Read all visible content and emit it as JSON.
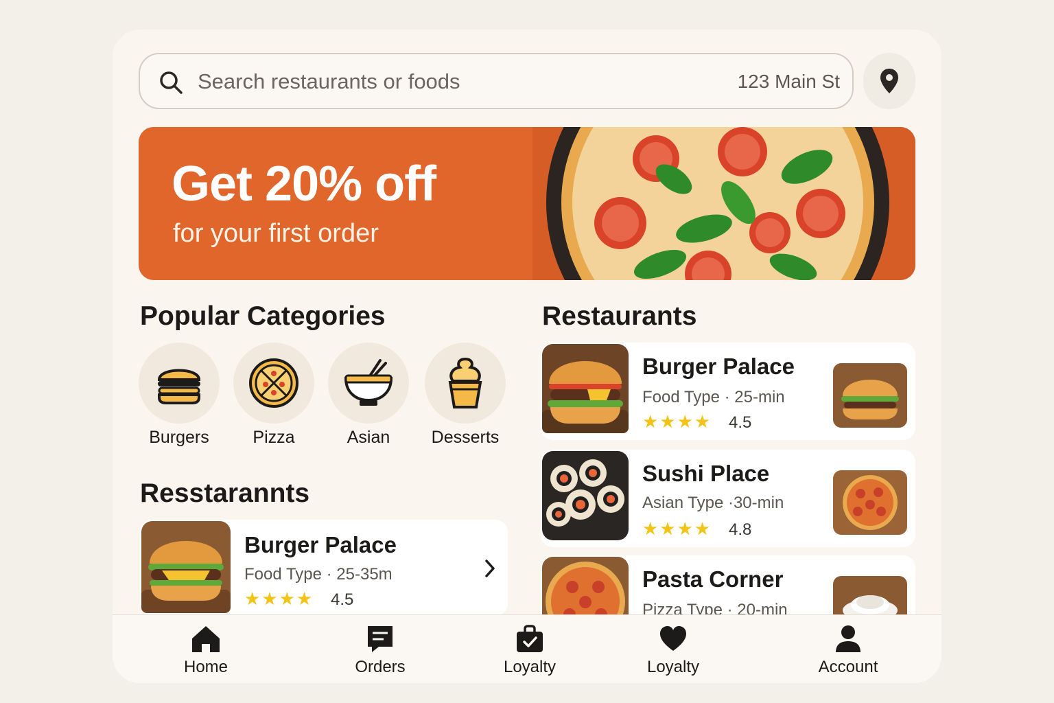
{
  "search": {
    "placeholder": "Search restaurants or foods",
    "address": "123 Main St"
  },
  "banner": {
    "title": "Get 20% off",
    "subtitle": "for your first order"
  },
  "categories_section": {
    "title": "Popular Categories",
    "items": [
      {
        "label": "Burgers",
        "icon": "burger-icon"
      },
      {
        "label": "Pizza",
        "icon": "pizza-icon"
      },
      {
        "label": "Asian",
        "icon": "noodle-bowl-icon"
      },
      {
        "label": "Desserts",
        "icon": "ice-cream-icon"
      }
    ]
  },
  "left_section": {
    "title": "Resstarannts",
    "card": {
      "name": "Burger Palace",
      "meta": "Food Type · 25-35m",
      "stars": "★★★★",
      "rating": "4.5"
    }
  },
  "right_section": {
    "title": "Restaurants",
    "items": [
      {
        "name": "Burger Palace",
        "meta": "Food Type · 25-min",
        "stars": "★★★★",
        "rating": "4.5"
      },
      {
        "name": "Sushi Place",
        "meta": "Asian Type ·30-min",
        "stars": "★★★★",
        "rating": "4.8"
      },
      {
        "name": "Pasta Corner",
        "meta": "Pizza Type · 20-min"
      }
    ]
  },
  "nav": [
    {
      "label": "Home",
      "icon": "home-icon"
    },
    {
      "label": "Orders",
      "icon": "orders-icon"
    },
    {
      "label": "Loyalty",
      "icon": "bag-icon"
    },
    {
      "label": "Loyalty",
      "icon": "heart-icon"
    },
    {
      "label": "Account",
      "icon": "account-icon"
    }
  ],
  "colors": {
    "accent": "#e0662c",
    "background": "#faf6ef",
    "star": "#f2c417"
  }
}
